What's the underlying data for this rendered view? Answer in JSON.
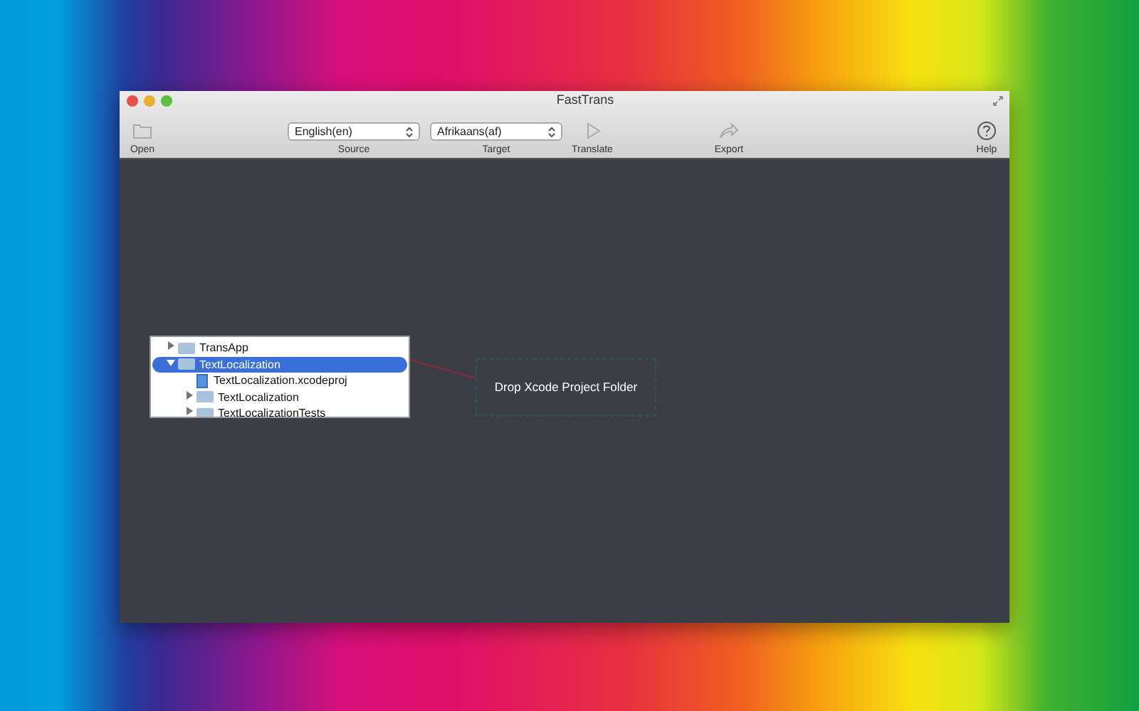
{
  "window": {
    "title": "FastTrans"
  },
  "toolbar": [
    {
      "kind": "button",
      "label": "Open",
      "disabled": true
    },
    {
      "kind": "popup",
      "label": "Source",
      "value": "English(en)"
    },
    {
      "kind": "popup",
      "label": "Target",
      "value": "Afrikaans(af)"
    },
    {
      "kind": "button",
      "label": "Translate",
      "disabled": true
    },
    {
      "kind": "button",
      "label": "Export",
      "disabled": true
    },
    {
      "kind": "button",
      "label": "Help",
      "disabled": false
    }
  ],
  "tree": [
    {
      "name": "TransApp",
      "kind": "folder",
      "expanded": false,
      "selected": false
    },
    {
      "name": "TextLocalization",
      "kind": "folder",
      "expanded": true,
      "selected": true,
      "children": [
        {
          "name": "TextLocalization.xcodeproj",
          "kind": "project",
          "selected": false
        },
        {
          "name": "TextLocalization",
          "kind": "folder",
          "expanded": false,
          "selected": false
        },
        {
          "name": "TextLocalizationTests",
          "kind": "folder",
          "expanded": false,
          "selected": false
        }
      ]
    }
  ],
  "drop_zone": {
    "label": "Drop Xcode Project Folder"
  }
}
